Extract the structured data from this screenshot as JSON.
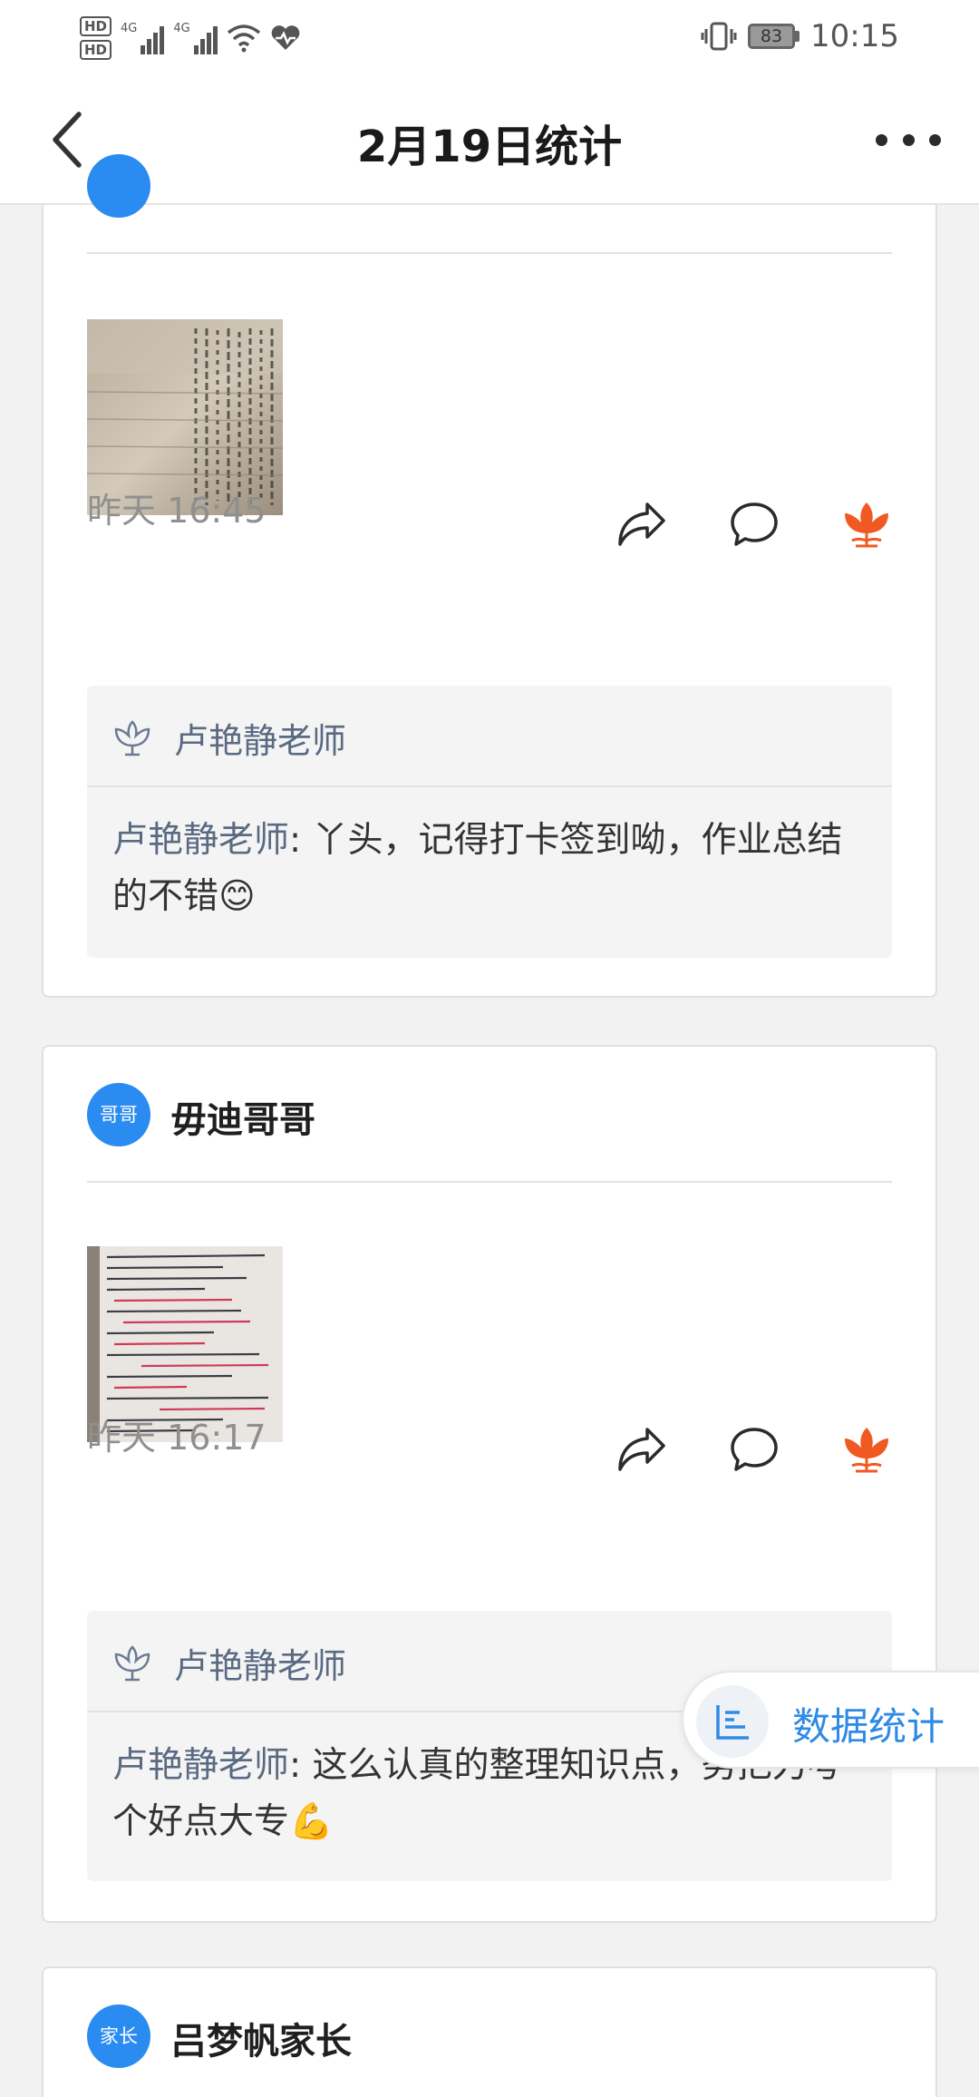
{
  "status_bar": {
    "hd1": "HD",
    "hd2": "HD",
    "net1": "4G",
    "net2": "4G",
    "battery": "83",
    "time": "10:15"
  },
  "header": {
    "title": "2月19日统计"
  },
  "posts": [
    {
      "time": "昨天 16:45",
      "comment_header": "卢艳静老师",
      "comment_author": "卢艳静老师",
      "comment_text": ": 丫头，记得打卡签到呦，作业总结的不错😊"
    },
    {
      "avatar_text": "哥哥",
      "user": "毋迪哥哥",
      "time": "昨天 16:17",
      "comment_header": "卢艳静老师",
      "comment_author": "卢艳静老师",
      "comment_text": ": 这么认真的整理知识点，努把力考个好点大专💪"
    },
    {
      "avatar_text": "家长",
      "user": "吕梦帆家长"
    }
  ],
  "float_button": {
    "label": "数据统计"
  },
  "colors": {
    "accent_blue": "#2a8bf0",
    "flower_orange": "#f05a22",
    "teacher_name": "#5a6a82"
  }
}
